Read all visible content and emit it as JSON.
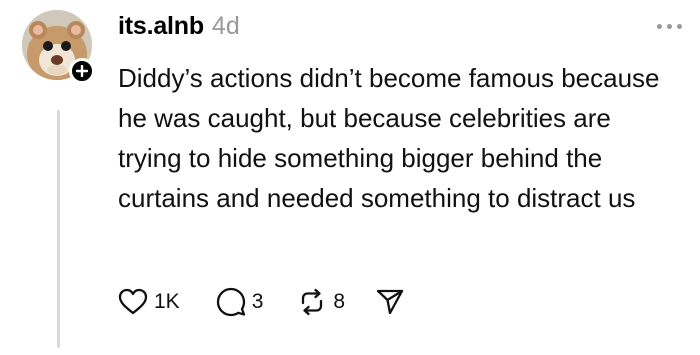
{
  "post": {
    "username": "its.alnb",
    "time": "4d",
    "text": "Diddy’s actions didn’t become famous because he was caught, but because celebrities are trying to hide something bigger behind the curtains and needed something to distract us"
  },
  "actions": {
    "likes": "1K",
    "replies": "3",
    "reposts": "8"
  },
  "icons": {
    "avatar": "hamster-avatar",
    "follow": "plus-icon",
    "more": "more-dots-icon",
    "like": "heart-icon",
    "reply": "comment-icon",
    "repost": "repost-icon",
    "share": "send-icon"
  },
  "colors": {
    "text": "#111111",
    "muted": "#999999",
    "thread_line": "#d9d9d9"
  }
}
